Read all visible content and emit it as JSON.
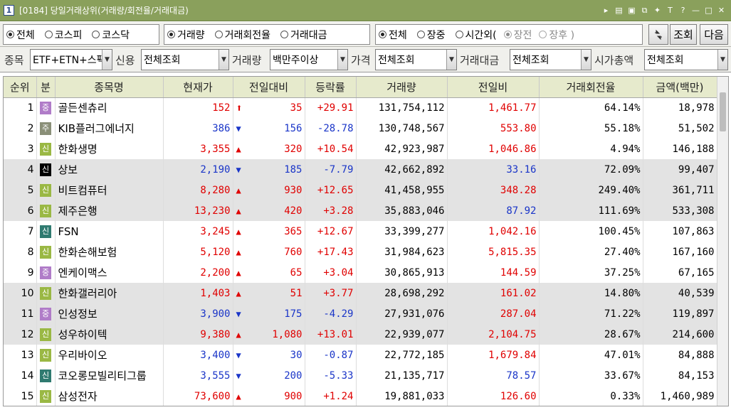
{
  "window": {
    "number": "1",
    "title": "[0184] 당일거래상위(거래량/회전율/거래대금)",
    "controls": [
      "▸",
      "▤",
      "▣",
      "⧉",
      "✦",
      "T",
      "?",
      "—",
      "□",
      "✕"
    ]
  },
  "filters": {
    "market": [
      {
        "label": "전체",
        "selected": true
      },
      {
        "label": "코스피",
        "selected": false
      },
      {
        "label": "코스닥",
        "selected": false
      }
    ],
    "sort": [
      {
        "label": "거래량",
        "selected": true
      },
      {
        "label": "거래회전율",
        "selected": false
      },
      {
        "label": "거래대금",
        "selected": false
      }
    ],
    "session": [
      {
        "label": "전체",
        "selected": true
      },
      {
        "label": "장중",
        "selected": false
      },
      {
        "label": "시간외(",
        "selected": false
      },
      {
        "label": "장전",
        "selected": true,
        "disabled": true
      },
      {
        "label": "장후  )",
        "selected": false,
        "disabled": true
      }
    ],
    "inquiry_button": "조회",
    "next_button": "다음"
  },
  "conditions": [
    {
      "label": "종목",
      "value": "ETF+ETN+스팩"
    },
    {
      "label": "신용",
      "value": "전체조회"
    },
    {
      "label": "거래량",
      "value": "백만주이상"
    },
    {
      "label": "가격",
      "value": "전체조회"
    },
    {
      "label": "거래대금",
      "value": "전체조회"
    },
    {
      "label": "시가총액",
      "value": "전체조회"
    }
  ],
  "table": {
    "headers": [
      "순위",
      "분",
      "종목명",
      "현재가",
      "전일대비",
      "등락률",
      "거래량",
      "전일비",
      "거래회전율",
      "금액(백만)"
    ],
    "rows": [
      {
        "rank": "1",
        "badge": "중",
        "badge_color": "purple",
        "name": "골든센츄리",
        "price": "152",
        "arrow": "⬆",
        "arrow_dir": "up",
        "limit": true,
        "change": "35",
        "rate": "+29.91",
        "volume": "131,754,112",
        "prev_ratio": "1,461.77",
        "ratio_dir": "up",
        "turnover": "64.14%",
        "amount": "18,978"
      },
      {
        "rank": "2",
        "badge": "주",
        "badge_color": "olive",
        "name": "KIB플러그에너지",
        "price": "386",
        "arrow": "▼",
        "arrow_dir": "dn",
        "change": "156",
        "rate": "-28.78",
        "volume": "130,748,567",
        "prev_ratio": "553.80",
        "ratio_dir": "up",
        "turnover": "55.18%",
        "amount": "51,502"
      },
      {
        "rank": "3",
        "badge": "신",
        "badge_color": "lime",
        "name": "한화생명",
        "price": "3,355",
        "arrow": "▲",
        "arrow_dir": "up",
        "change": "320",
        "rate": "+10.54",
        "volume": "42,923,987",
        "prev_ratio": "1,046.86",
        "ratio_dir": "up",
        "turnover": "4.94%",
        "amount": "146,188"
      },
      {
        "rank": "4",
        "badge": "신",
        "badge_color": "black",
        "name": "상보",
        "price": "2,190",
        "arrow": "▼",
        "arrow_dir": "dn",
        "change": "185",
        "rate": "-7.79",
        "volume": "42,662,892",
        "prev_ratio": "33.16",
        "ratio_dir": "dn",
        "turnover": "72.09%",
        "amount": "99,407"
      },
      {
        "rank": "5",
        "badge": "신",
        "badge_color": "lime",
        "name": "비트컴퓨터",
        "price": "8,280",
        "arrow": "▲",
        "arrow_dir": "up",
        "change": "930",
        "rate": "+12.65",
        "volume": "41,458,955",
        "prev_ratio": "348.28",
        "ratio_dir": "up",
        "turnover": "249.40%",
        "amount": "361,711"
      },
      {
        "rank": "6",
        "badge": "신",
        "badge_color": "lime",
        "name": "제주은행",
        "price": "13,230",
        "arrow": "▲",
        "arrow_dir": "up",
        "change": "420",
        "rate": "+3.28",
        "volume": "35,883,046",
        "prev_ratio": "87.92",
        "ratio_dir": "dn",
        "turnover": "111.69%",
        "amount": "533,308"
      },
      {
        "rank": "7",
        "badge": "신",
        "badge_color": "teal",
        "name": "FSN",
        "price": "3,245",
        "arrow": "▲",
        "arrow_dir": "up",
        "change": "365",
        "rate": "+12.67",
        "volume": "33,399,277",
        "prev_ratio": "1,042.16",
        "ratio_dir": "up",
        "turnover": "100.45%",
        "amount": "107,863"
      },
      {
        "rank": "8",
        "badge": "신",
        "badge_color": "lime",
        "name": "한화손해보험",
        "price": "5,120",
        "arrow": "▲",
        "arrow_dir": "up",
        "change": "760",
        "rate": "+17.43",
        "volume": "31,984,623",
        "prev_ratio": "5,815.35",
        "ratio_dir": "up",
        "turnover": "27.40%",
        "amount": "167,160"
      },
      {
        "rank": "9",
        "badge": "중",
        "badge_color": "purple",
        "name": "엔케이맥스",
        "price": "2,200",
        "arrow": "▲",
        "arrow_dir": "up",
        "change": "65",
        "rate": "+3.04",
        "volume": "30,865,913",
        "prev_ratio": "144.59",
        "ratio_dir": "up",
        "turnover": "37.25%",
        "amount": "67,165"
      },
      {
        "rank": "10",
        "badge": "신",
        "badge_color": "lime",
        "name": "한화갤러리아",
        "price": "1,403",
        "arrow": "▲",
        "arrow_dir": "up",
        "change": "51",
        "rate": "+3.77",
        "volume": "28,698,292",
        "prev_ratio": "161.02",
        "ratio_dir": "up",
        "turnover": "14.80%",
        "amount": "40,539"
      },
      {
        "rank": "11",
        "badge": "중",
        "badge_color": "purple",
        "name": "인성정보",
        "price": "3,900",
        "arrow": "▼",
        "arrow_dir": "dn",
        "change": "175",
        "rate": "-4.29",
        "volume": "27,931,076",
        "prev_ratio": "287.04",
        "ratio_dir": "up",
        "turnover": "71.22%",
        "amount": "119,897"
      },
      {
        "rank": "12",
        "badge": "신",
        "badge_color": "lime",
        "name": "성우하이텍",
        "price": "9,380",
        "arrow": "▲",
        "arrow_dir": "up",
        "change": "1,080",
        "rate": "+13.01",
        "volume": "22,939,077",
        "prev_ratio": "2,104.75",
        "ratio_dir": "up",
        "turnover": "28.67%",
        "amount": "214,600"
      },
      {
        "rank": "13",
        "badge": "신",
        "badge_color": "lime",
        "name": "우리바이오",
        "price": "3,400",
        "arrow": "▼",
        "arrow_dir": "dn",
        "change": "30",
        "rate": "-0.87",
        "volume": "22,772,185",
        "prev_ratio": "1,679.84",
        "ratio_dir": "up",
        "turnover": "47.01%",
        "amount": "84,888"
      },
      {
        "rank": "14",
        "badge": "신",
        "badge_color": "teal",
        "name": "코오롱모빌리티그룹",
        "price": "3,555",
        "arrow": "▼",
        "arrow_dir": "dn",
        "change": "200",
        "rate": "-5.33",
        "volume": "21,135,717",
        "prev_ratio": "78.57",
        "ratio_dir": "dn",
        "turnover": "33.67%",
        "amount": "84,153"
      },
      {
        "rank": "15",
        "badge": "신",
        "badge_color": "lime",
        "name": "삼성전자",
        "price": "73,600",
        "arrow": "▲",
        "arrow_dir": "up",
        "change": "900",
        "rate": "+1.24",
        "volume": "19,881,033",
        "prev_ratio": "126.60",
        "ratio_dir": "up",
        "turnover": "0.33%",
        "amount": "1,460,989"
      }
    ]
  },
  "colors": {
    "title_bar": "#8aa05c",
    "header_bg": "#e6eacc",
    "up": "#e00000",
    "down": "#1a35c8",
    "shaded_row": "#e3e3e3"
  }
}
